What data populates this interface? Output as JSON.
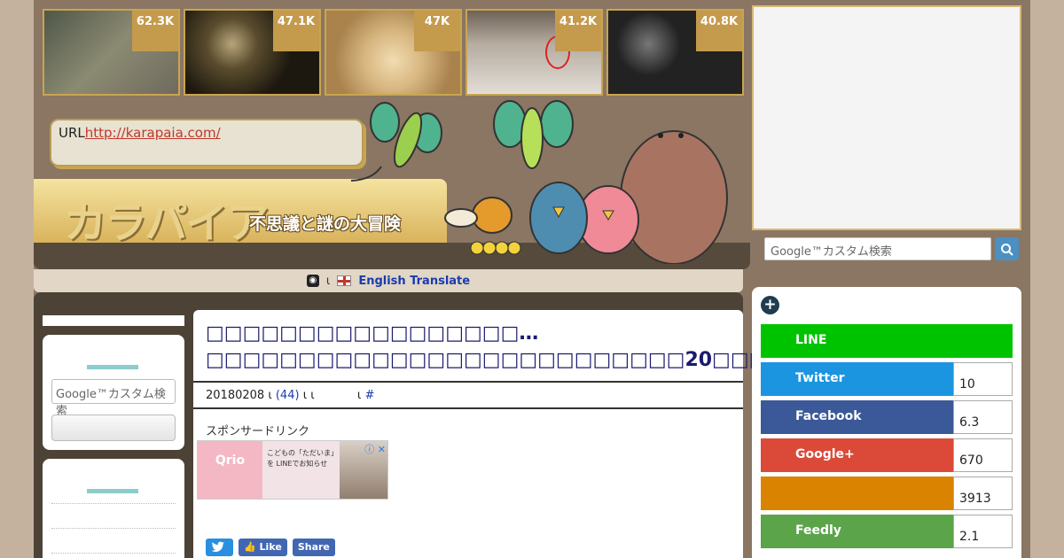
{
  "thumbnails": [
    {
      "count": "62.3K",
      "colors": [
        "#5d6457",
        "#8a7f6d"
      ]
    },
    {
      "count": "47.1K",
      "colors": [
        "#2b2416",
        "#7c6a3d"
      ]
    },
    {
      "count": "47K",
      "colors": [
        "#e0c48a",
        "#b8925a"
      ]
    },
    {
      "count": "41.2K",
      "colors": [
        "#9a8f82",
        "#d9d2c8"
      ]
    },
    {
      "count": "40.8K",
      "colors": [
        "#1b1b1b",
        "#6d6d6d"
      ]
    }
  ],
  "header": {
    "url_label": "URL",
    "url_link": "http://karapaia.com/",
    "logo_text": "カラパイア",
    "logo_tagline": "不思議と謎の大冒険"
  },
  "translate": {
    "separator": "ι",
    "label": "English Translate"
  },
  "left_sidebar": {
    "search_placeholder": "Google™カスタム検索"
  },
  "article": {
    "title": "□□□□□□□□□□□□□□□□□…□□□□□□□□□□□□□□□□□□□□□□□□□□20□□□□",
    "date": "20180208",
    "sep1": "ι",
    "comments": "(44)",
    "sep2": "ι ι",
    "sep3": "ι",
    "hash": "#",
    "sponsor": "スポンサードリンク",
    "ad": {
      "brand": "Qrio",
      "copy": "こどもの「ただいま」を LINEでお知らせ",
      "close": "ⓘ ✕"
    },
    "share_buttons": [
      {
        "label": "",
        "color": "#2b8fe0"
      },
      {
        "label": "Like",
        "color": "#4267b2"
      },
      {
        "label": "Share",
        "color": "#4267b2"
      }
    ]
  },
  "right_sidebar": {
    "search_placeholder": "Google™カスタム検索",
    "search_icon": "search-icon",
    "plus_icon": "plus-icon",
    "share_rows": [
      {
        "name": "LINE",
        "count": "",
        "color": "#00c300"
      },
      {
        "name": "Twitter",
        "count": "10",
        "color": "#1b95e0"
      },
      {
        "name": "Facebook",
        "count": "6.3",
        "color": "#3b5998"
      },
      {
        "name": "Google+",
        "count": "670",
        "color": "#db4a39"
      },
      {
        "name": "",
        "count": "3913",
        "color": "#d98300"
      },
      {
        "name": "Feedly",
        "count": "2.1",
        "color": "#5ca44a"
      }
    ]
  }
}
